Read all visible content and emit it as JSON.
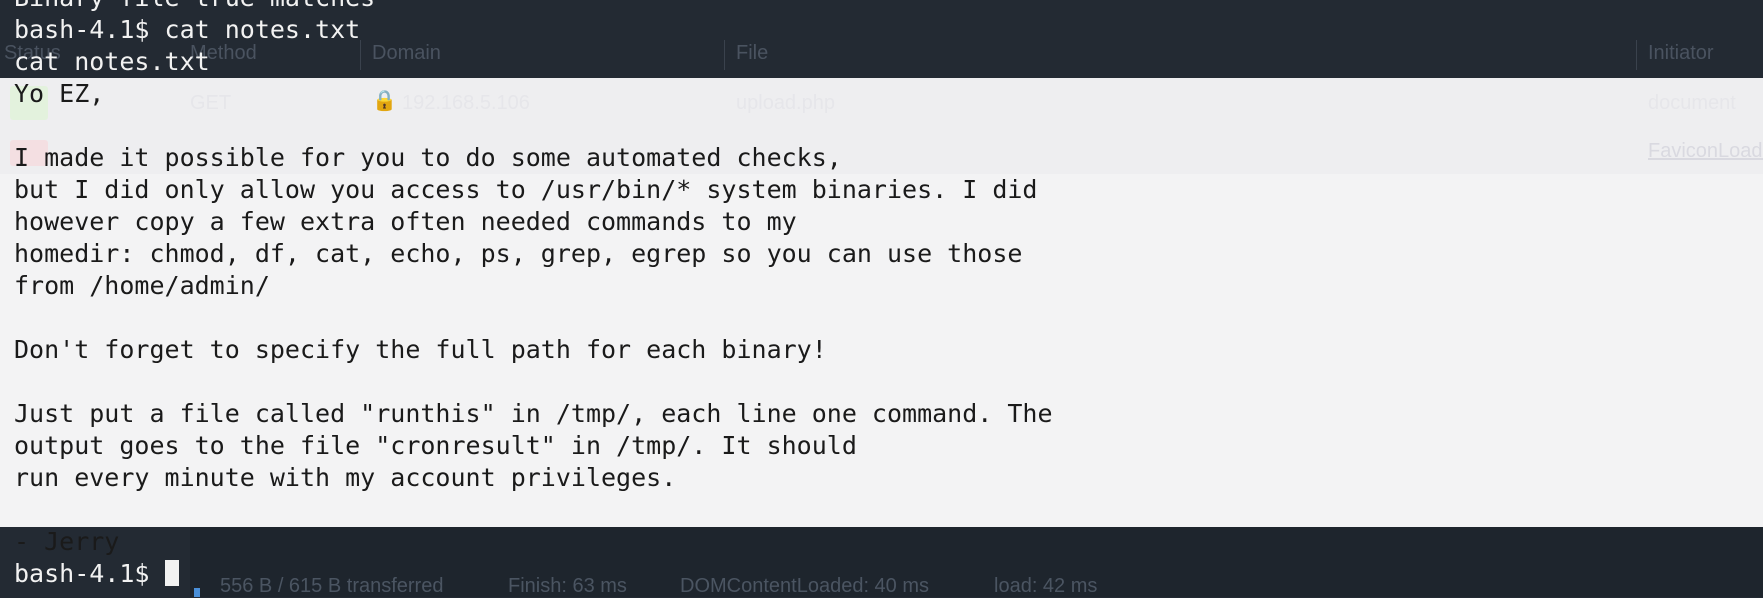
{
  "background_ui": {
    "columns": [
      "Status",
      "Method",
      "Domain",
      "File",
      "Initiator"
    ],
    "rows": [
      {
        "method": "GET",
        "domain": "192.168.5.106",
        "file": "upload.php",
        "initiator": "document"
      },
      {
        "method": "",
        "domain": "",
        "file": "",
        "initiator": "FaviconLoader"
      }
    ],
    "status_bar": {
      "transferred": "556 B / 615 B transferred",
      "finish": "Finish: 63 ms",
      "dom": "DOMContentLoaded: 40 ms",
      "load": "load: 42 ms"
    }
  },
  "terminal": {
    "top_cut": "Binary file true matches",
    "command_line": "bash-4.1$ cat notes.txt",
    "echo_line": "cat notes.txt",
    "note_lines": [
      "Yo EZ,",
      "",
      "I made it possible for you to do some automated checks,",
      "but I did only allow you access to /usr/bin/* system binaries. I did",
      "however copy a few extra often needed commands to my",
      "homedir: chmod, df, cat, echo, ps, grep, egrep so you can use those",
      "from /home/admin/",
      "",
      "Don't forget to specify the full path for each binary!",
      "",
      "Just put a file called \"runthis\" in /tmp/, each line one command. The",
      "output goes to the file \"cronresult\" in /tmp/. It should",
      "run every minute with my account privileges.",
      "",
      "- Jerry"
    ],
    "prompt": "bash-4.1$"
  },
  "colors": {
    "terminal_bg": "#232a33",
    "overlay_bg": "#f3f3f4",
    "terminal_fg": "#f2f2f2",
    "overlay_fg": "#1a1a1a"
  }
}
